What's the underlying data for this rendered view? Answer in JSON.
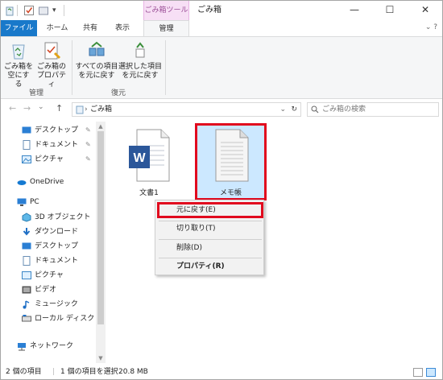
{
  "titlebar": {
    "context_tab": "ごみ箱ツール",
    "title": "ごみ箱",
    "minimize": "—",
    "maximize": "☐",
    "close": "✕"
  },
  "tabs": {
    "file": "ファイル",
    "home": "ホーム",
    "share": "共有",
    "view": "表示",
    "manage": "管理",
    "right_icons": "⌄ ?"
  },
  "ribbon": {
    "empty_bin": [
      "ごみ箱を",
      "空にする"
    ],
    "bin_props": [
      "ごみ箱の",
      "プロパティ"
    ],
    "restore_all": [
      "すべての項目",
      "を元に戻す"
    ],
    "restore_sel": [
      "選択した項目",
      "を元に戻す"
    ],
    "group_manage": "管理",
    "group_restore": "復元"
  },
  "address": {
    "back": "←",
    "forward": "→",
    "recent": "⌄",
    "up": "↑",
    "path": "ごみ箱",
    "dropdown": "⌄",
    "refresh": "↻",
    "search_placeholder": "ごみ箱の検索"
  },
  "nav": {
    "quick": [
      {
        "label": "デスクトップ",
        "pin": "✎"
      },
      {
        "label": "ドキュメント",
        "pin": "✎"
      },
      {
        "label": "ピクチャ",
        "pin": "✎"
      }
    ],
    "onedrive": "OneDrive",
    "pc": "PC",
    "pc_items": [
      "3D オブジェクト",
      "ダウンロード",
      "デスクトップ",
      "ドキュメント",
      "ピクチャ",
      "ビデオ",
      "ミュージック",
      "ローカル ディスク (C:"
    ],
    "network": "ネットワーク"
  },
  "files": [
    {
      "name": "文書1",
      "type": "word"
    },
    {
      "name": "メモ帳",
      "type": "text"
    }
  ],
  "menu": {
    "restore": "元に戻す(E)",
    "cut": "切り取り(T)",
    "delete": "削除(D)",
    "properties": "プロパティ(R)"
  },
  "status": {
    "count": "2 個の項目",
    "selected": "1 個の項目を選択",
    "size": "20.8 MB"
  },
  "colors": {
    "accent": "#1979ca",
    "context_tab": "#f7dff5",
    "selection": "#cce8ff",
    "highlight_border": "#e10a1e"
  }
}
